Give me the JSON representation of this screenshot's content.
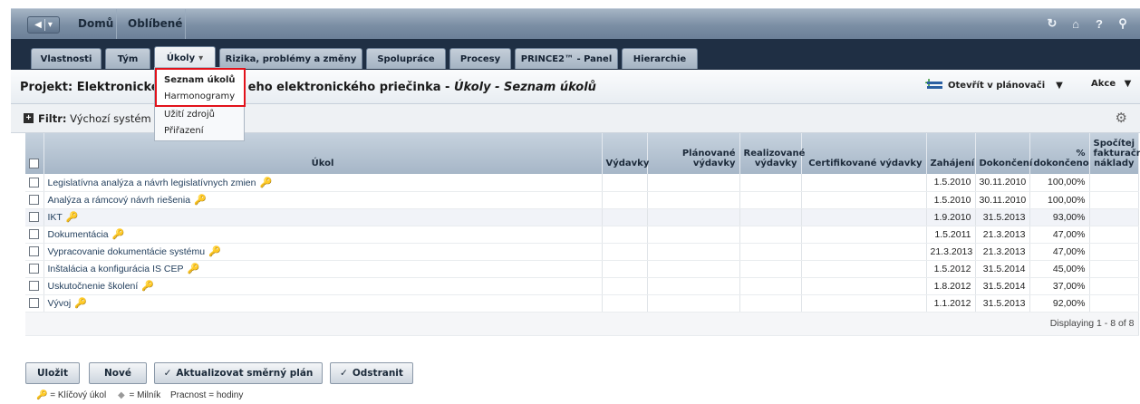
{
  "topbar": {
    "home": "Domů",
    "favorites": "Oblíbené"
  },
  "tabs": [
    "Vlastnosti",
    "Tým",
    "Úkoly",
    "Rizika, problémy a změny",
    "Spolupráce",
    "Procesy",
    "PRINCE2™ - Panel",
    "Hierarchie"
  ],
  "active_tab": "Úkoly",
  "dropdown": {
    "items": [
      "Seznam úkolů",
      "Harmonogramy",
      "Užití zdrojů",
      "Přiřazení"
    ],
    "highlighted": [
      "Seznam úkolů",
      "Harmonogramy"
    ]
  },
  "header": {
    "project_prefix": "Projekt: Elektronické",
    "project_rest": "eho elektronického priečinka - ",
    "project_italic": "Úkoly - Seznam úkolů",
    "planner_label": "Otevřít v plánovači",
    "actions_label": "Akce"
  },
  "filter": {
    "label": "Filtr:",
    "value": "Výchozí systém"
  },
  "table": {
    "columns": [
      "Úkol",
      "Výdavky",
      "Plánované výdavky",
      "Realizované výdavky",
      "Certifikované výdavky",
      "Zahájení",
      "Dokončení",
      "% dokončeno",
      "Spočítej fakturační náklady"
    ],
    "rows": [
      {
        "name": "Legislatívna analýza a návrh legislatívnych zmien",
        "start": "1.5.2010",
        "end": "30.11.2010",
        "pct": "100,00%"
      },
      {
        "name": "Analýza a rámcový návrh riešenia",
        "start": "1.5.2010",
        "end": "30.11.2010",
        "pct": "100,00%"
      },
      {
        "name": "IKT",
        "start": "1.9.2010",
        "end": "31.5.2013",
        "pct": "93,00%"
      },
      {
        "name": "Dokumentácia",
        "start": "1.5.2011",
        "end": "21.3.2013",
        "pct": "47,00%"
      },
      {
        "name": "Vypracovanie dokumentácie systému",
        "start": "21.3.2013",
        "end": "21.3.2013",
        "pct": "47,00%"
      },
      {
        "name": "Inštalácia a konfigurácia IS CEP",
        "start": "1.5.2012",
        "end": "31.5.2014",
        "pct": "45,00%"
      },
      {
        "name": "Uskutočnenie školení",
        "start": "1.8.2012",
        "end": "31.5.2014",
        "pct": "37,00%"
      },
      {
        "name": "Vývoj",
        "start": "1.1.2012",
        "end": "31.5.2013",
        "pct": "92,00%"
      }
    ],
    "paging": "Displaying 1 - 8 of 8"
  },
  "buttons": {
    "save": "Uložit",
    "new": "Nové",
    "update_plan": "Aktualizovat směrný plán",
    "delete": "Odstranit"
  },
  "legend": {
    "key_task": "= Klíčový úkol",
    "milestone": "= Milník",
    "effort": "Pracnost = hodiny"
  },
  "colors": {
    "topbar": "#7b8ea4",
    "tabstrip": "#1f2f44",
    "highlight": "#e2121b"
  }
}
